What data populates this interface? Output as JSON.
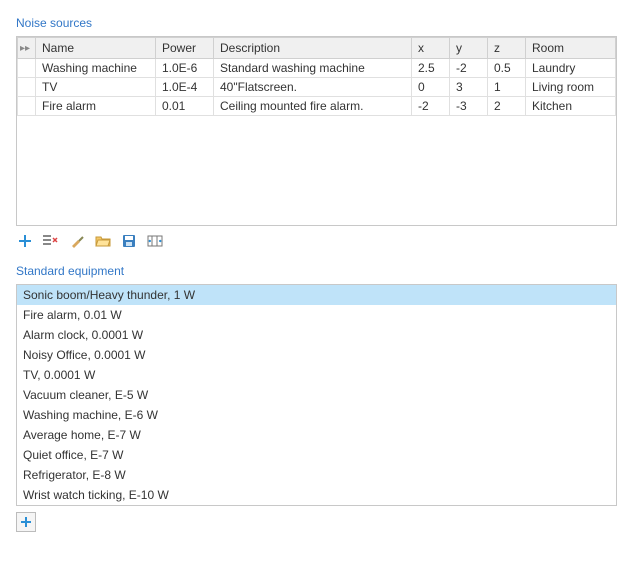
{
  "noise_sources": {
    "title": "Noise sources",
    "columns": {
      "name": "Name",
      "power": "Power",
      "description": "Description",
      "x": "x",
      "y": "y",
      "z": "z",
      "room": "Room"
    },
    "rows": [
      {
        "name": "Washing machine",
        "power": "1.0E-6",
        "description": "Standard washing machine",
        "x": "2.5",
        "y": "-2",
        "z": "0.5",
        "room": "Laundry"
      },
      {
        "name": "TV",
        "power": "1.0E-4",
        "description": "40\"Flatscreen.",
        "x": "0",
        "y": "3",
        "z": "1",
        "room": "Living room"
      },
      {
        "name": "Fire alarm",
        "power": "0.01",
        "description": "Ceiling mounted fire alarm.",
        "x": "-2",
        "y": "-3",
        "z": "2",
        "room": "Kitchen"
      }
    ]
  },
  "standard_equipment": {
    "title": "Standard equipment",
    "items": [
      "Sonic boom/Heavy thunder, 1 W",
      "Fire alarm, 0.01 W",
      "Alarm clock, 0.0001 W",
      "Noisy Office, 0.0001 W",
      "TV, 0.0001 W",
      "Vacuum cleaner, E-5 W",
      "Washing machine, E-6 W",
      "Average home, E-7 W",
      "Quiet office, E-7 W",
      "Refrigerator, E-8 W",
      "Wrist watch ticking, E-10 W"
    ],
    "selected_index": 0
  },
  "icons": {
    "add": "add-icon",
    "delete": "delete-icon",
    "clear": "clear-icon",
    "load": "load-icon",
    "save": "save-icon",
    "autosize": "autosize-icon"
  }
}
